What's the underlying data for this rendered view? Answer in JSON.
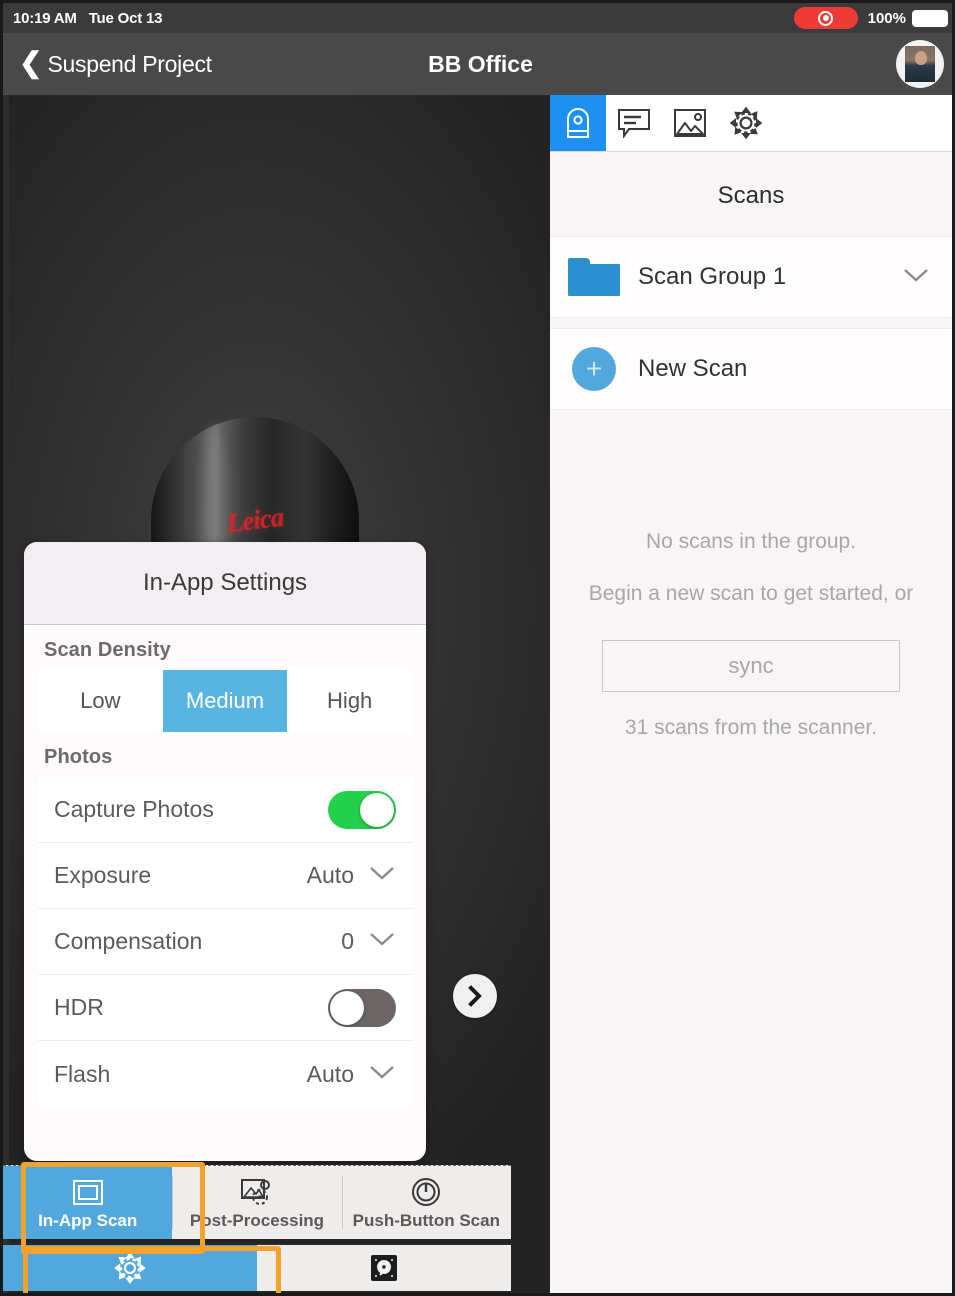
{
  "status_bar": {
    "time": "10:19 AM",
    "date": "Tue Oct 13",
    "recording_icon": "record-indicator-icon",
    "battery_percent": "100%"
  },
  "nav_bar": {
    "back_label": "Suspend Project",
    "back_icon": "chevron-left-icon",
    "title": "BB Office",
    "avatar_name": "user-avatar"
  },
  "viewport": {
    "device_brand": "Leica",
    "expand_icon": "chevron-right-icon"
  },
  "right_panel": {
    "tabs": [
      {
        "icon": "scanner-tab-icon",
        "active": true
      },
      {
        "icon": "annotation-tab-icon",
        "active": false
      },
      {
        "icon": "image-tab-icon",
        "active": false
      },
      {
        "icon": "gear-tab-icon",
        "active": false
      }
    ],
    "title": "Scans",
    "rows": [
      {
        "icon": "folder-icon",
        "label": "Scan Group 1",
        "accessory": "chevron-down-icon"
      },
      {
        "icon": "plus-circle-icon",
        "label": "New Scan",
        "accessory": ""
      }
    ],
    "empty_state": {
      "line1": "No scans in the group.",
      "line2": "Begin a new scan to get started, or",
      "sync_label": "sync",
      "line3": "31 scans from the scanner."
    }
  },
  "settings_card": {
    "title": "In-App Settings",
    "sections": [
      {
        "header": "Scan Density",
        "segments": [
          {
            "label": "Low",
            "selected": false
          },
          {
            "label": "Medium",
            "selected": true
          },
          {
            "label": "High",
            "selected": false
          }
        ]
      },
      {
        "header": "Photos",
        "rows": [
          {
            "name": "Capture Photos",
            "control": "toggle",
            "value": "on"
          },
          {
            "name": "Exposure",
            "control": "select",
            "value": "Auto"
          },
          {
            "name": "Compensation",
            "control": "select",
            "value": "0"
          },
          {
            "name": "HDR",
            "control": "toggle",
            "value": "off"
          },
          {
            "name": "Flash",
            "control": "select",
            "value": "Auto"
          }
        ]
      }
    ]
  },
  "bottom_toolbar": {
    "row1": [
      {
        "label": "In-App Scan",
        "icon": "in-app-scan-icon",
        "selected": true
      },
      {
        "label": "Post-Processing",
        "icon": "post-processing-icon",
        "selected": false
      },
      {
        "label": "Push-Button Scan",
        "icon": "power-button-icon",
        "selected": false
      }
    ],
    "row2": [
      {
        "icon": "gear-icon",
        "selected": true
      },
      {
        "icon": "hard-disk-icon",
        "selected": false
      }
    ]
  },
  "colors": {
    "accent_blue": "#52a8dd",
    "tab_active_blue": "#1e90f2",
    "highlight_orange": "#f2a32c",
    "toggle_on_green": "#24cf4b",
    "brand_red": "#d2262a"
  }
}
